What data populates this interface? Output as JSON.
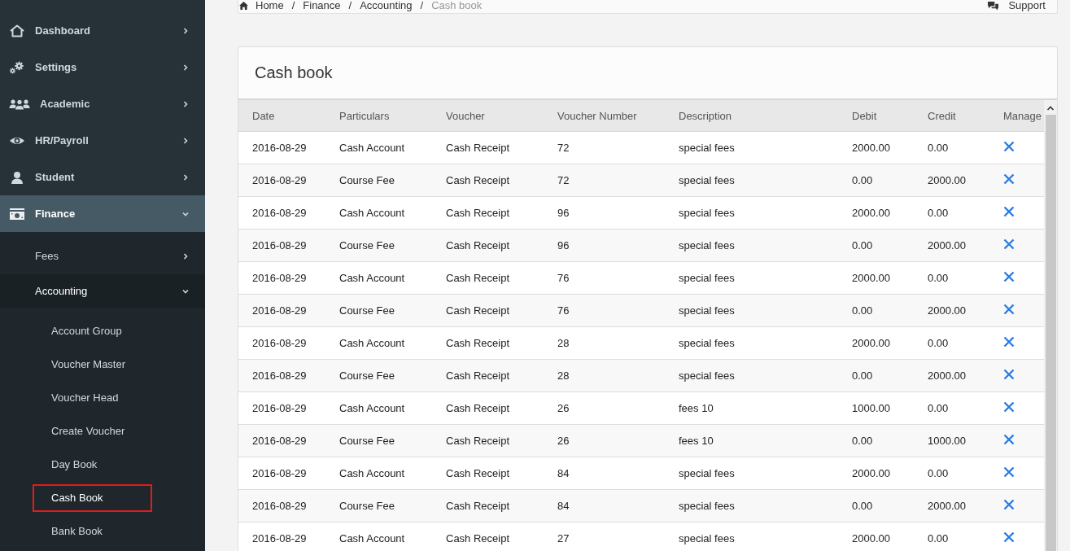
{
  "sidebar": {
    "items": [
      {
        "label": "Dashboard",
        "selected": false,
        "expanded": false
      },
      {
        "label": "Settings",
        "selected": false,
        "expanded": false
      },
      {
        "label": "Academic",
        "selected": false,
        "expanded": false
      },
      {
        "label": "HR/Payroll",
        "selected": false,
        "expanded": false
      },
      {
        "label": "Student",
        "selected": false,
        "expanded": false
      },
      {
        "label": "Finance",
        "selected": true,
        "expanded": true,
        "children": [
          {
            "label": "Fees",
            "expanded": false
          },
          {
            "label": "Accounting",
            "expanded": true,
            "children": [
              {
                "label": "Account Group",
                "selected": false
              },
              {
                "label": "Voucher Master",
                "selected": false
              },
              {
                "label": "Voucher Head",
                "selected": false
              },
              {
                "label": "Create Voucher",
                "selected": false
              },
              {
                "label": "Day Book",
                "selected": false
              },
              {
                "label": "Cash Book",
                "selected": true
              },
              {
                "label": "Bank Book",
                "selected": false
              }
            ]
          }
        ]
      }
    ]
  },
  "breadcrumb": {
    "items": [
      {
        "label": "Home",
        "current": false
      },
      {
        "separator": "/",
        "label": "Finance",
        "current": false
      },
      {
        "separator": "/",
        "label": "Accounting",
        "current": false
      },
      {
        "separator": "/",
        "label": "Cash book",
        "current": true
      }
    ],
    "support": "Support"
  },
  "card": {
    "title": "Cash book",
    "table": {
      "columns": [
        "Date",
        "Particulars",
        "Voucher",
        "Voucher Number",
        "Description",
        "Debit",
        "Credit",
        "Manage"
      ],
      "rows": [
        [
          "2016-08-29",
          "Cash Account",
          "Cash Receipt",
          "72",
          "special fees",
          "2000.00",
          "0.00"
        ],
        [
          "2016-08-29",
          "Course Fee",
          "Cash Receipt",
          "72",
          "special fees",
          "0.00",
          "2000.00"
        ],
        [
          "2016-08-29",
          "Cash Account",
          "Cash Receipt",
          "96",
          "special fees",
          "2000.00",
          "0.00"
        ],
        [
          "2016-08-29",
          "Course Fee",
          "Cash Receipt",
          "96",
          "special fees",
          "0.00",
          "2000.00"
        ],
        [
          "2016-08-29",
          "Cash Account",
          "Cash Receipt",
          "76",
          "special fees",
          "2000.00",
          "0.00"
        ],
        [
          "2016-08-29",
          "Course Fee",
          "Cash Receipt",
          "76",
          "special fees",
          "0.00",
          "2000.00"
        ],
        [
          "2016-08-29",
          "Cash Account",
          "Cash Receipt",
          "28",
          "special fees",
          "2000.00",
          "0.00"
        ],
        [
          "2016-08-29",
          "Course Fee",
          "Cash Receipt",
          "28",
          "special fees",
          "0.00",
          "2000.00"
        ],
        [
          "2016-08-29",
          "Cash Account",
          "Cash Receipt",
          "26",
          "fees 10",
          "1000.00",
          "0.00"
        ],
        [
          "2016-08-29",
          "Course Fee",
          "Cash Receipt",
          "26",
          "fees 10",
          "0.00",
          "1000.00"
        ],
        [
          "2016-08-29",
          "Cash Account",
          "Cash Receipt",
          "84",
          "special fees",
          "2000.00",
          "0.00"
        ],
        [
          "2016-08-29",
          "Course Fee",
          "Cash Receipt",
          "84",
          "special fees",
          "0.00",
          "2000.00"
        ],
        [
          "2016-08-29",
          "Cash Account",
          "Cash Receipt",
          "27",
          "special fees",
          "2000.00",
          "0.00"
        ]
      ]
    }
  }
}
